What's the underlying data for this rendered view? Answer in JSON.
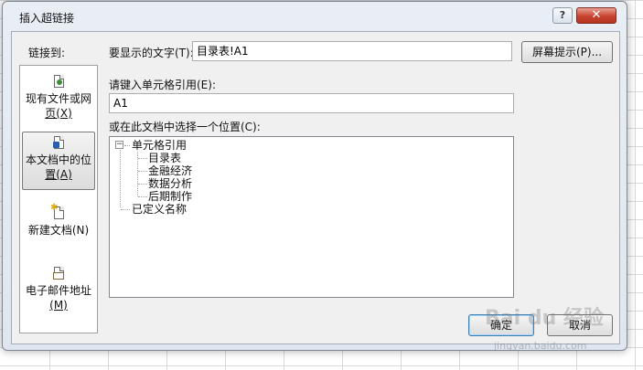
{
  "dialog": {
    "title": "插入超链接",
    "help_label": "?",
    "close_label": "✕"
  },
  "link_to": {
    "label": "链接到:",
    "items": [
      {
        "label": "现有文件或网页",
        "line1": "现有文件或网",
        "line2": "页(X)",
        "icon": "web-page-icon",
        "selected": false
      },
      {
        "label": "本文档中的位置",
        "line1": "本文档中的位",
        "line2": "置(A)",
        "icon": "place-in-document-icon",
        "selected": true
      },
      {
        "label": "新建文档",
        "line1": "新建文档(N)",
        "line2": "",
        "icon": "new-document-icon",
        "selected": false
      },
      {
        "label": "电子邮件地址",
        "line1": "电子邮件地址",
        "line2": "(M)",
        "icon": "email-icon",
        "selected": false
      }
    ]
  },
  "text_to_display": {
    "label": "要显示的文字(T):",
    "value": "目录表!A1"
  },
  "screentip_button": "屏幕提示(P)...",
  "cell_reference": {
    "label": "请键入单元格引用(E):",
    "value": "A1"
  },
  "place_in_document": {
    "label": "或在此文档中选择一个位置(C):",
    "tree": {
      "root": "单元格引用",
      "children": [
        "目录表",
        "金融经济",
        "数据分析",
        "后期制作"
      ],
      "defined_names": "已定义名称"
    }
  },
  "buttons": {
    "ok": "确定",
    "cancel": "取消"
  },
  "watermark": {
    "text": "Bai du 经验",
    "url": "jingyan.baidu.com"
  }
}
